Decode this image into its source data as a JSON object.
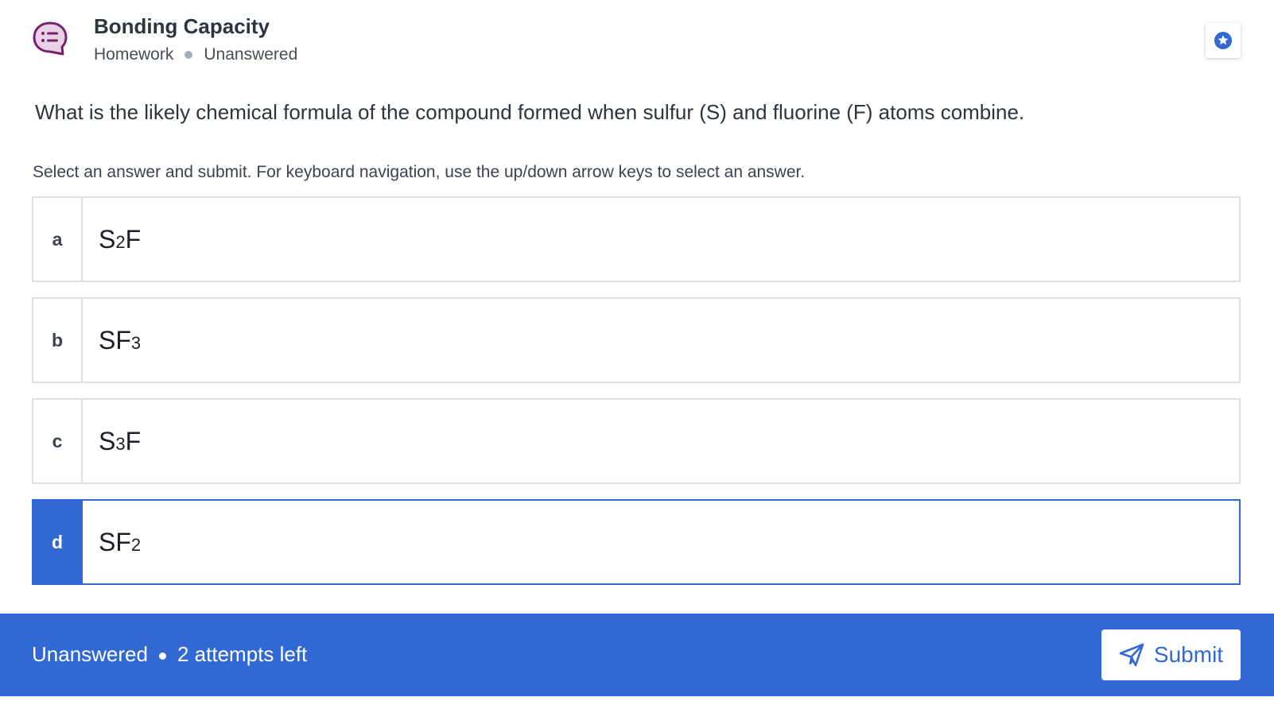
{
  "header": {
    "icon": "chat-list-icon",
    "title": "Bonding Capacity",
    "type": "Homework",
    "status": "Unanswered",
    "bookmark_icon": "star-icon"
  },
  "question": "What is the likely chemical formula of the compound formed when sulfur (S) and fluorine (F) atoms combine.",
  "instructions": "Select an answer and submit. For keyboard navigation, use the up/down arrow keys to select an answer.",
  "options": [
    {
      "letter": "a",
      "parts": [
        "S",
        "2",
        "F"
      ]
    },
    {
      "letter": "b",
      "parts": [
        "SF",
        "3",
        ""
      ]
    },
    {
      "letter": "c",
      "parts": [
        "S",
        "3",
        "F"
      ]
    },
    {
      "letter": "d",
      "parts": [
        "SF",
        "2",
        ""
      ]
    }
  ],
  "selected_option": "d",
  "footer": {
    "status": "Unanswered",
    "attempts": "2 attempts left",
    "submit_label": "Submit",
    "submit_icon": "send-icon"
  },
  "colors": {
    "accent": "#3169d4",
    "icon_purple": "#7a1f6e",
    "border": "#dcdfe3"
  }
}
